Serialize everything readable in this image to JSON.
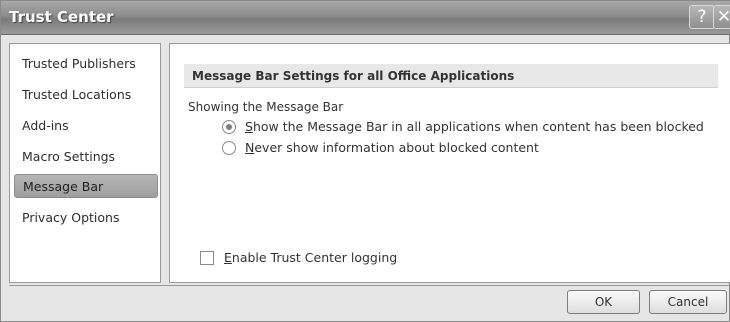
{
  "window": {
    "title": "Trust Center",
    "help_glyph": "?",
    "close_glyph": "✕"
  },
  "sidebar": {
    "items": [
      {
        "label": "Trusted Publishers",
        "selected": false
      },
      {
        "label": "Trusted Locations",
        "selected": false
      },
      {
        "label": "Add-ins",
        "selected": false
      },
      {
        "label": "Macro Settings",
        "selected": false
      },
      {
        "label": "Message Bar",
        "selected": true
      },
      {
        "label": "Privacy Options",
        "selected": false
      }
    ]
  },
  "main": {
    "section_title": "Message Bar Settings for all Office Applications",
    "group_label": "Showing the Message Bar",
    "options": [
      {
        "accel": "S",
        "rest": "how the Message Bar in all applications when content has been blocked",
        "checked": true
      },
      {
        "accel": "N",
        "rest": "ever show information about blocked content",
        "checked": false
      }
    ],
    "logging": {
      "accel": "E",
      "rest": "nable Trust Center logging",
      "checked": false
    }
  },
  "buttons": {
    "ok": "OK",
    "cancel": "Cancel"
  }
}
